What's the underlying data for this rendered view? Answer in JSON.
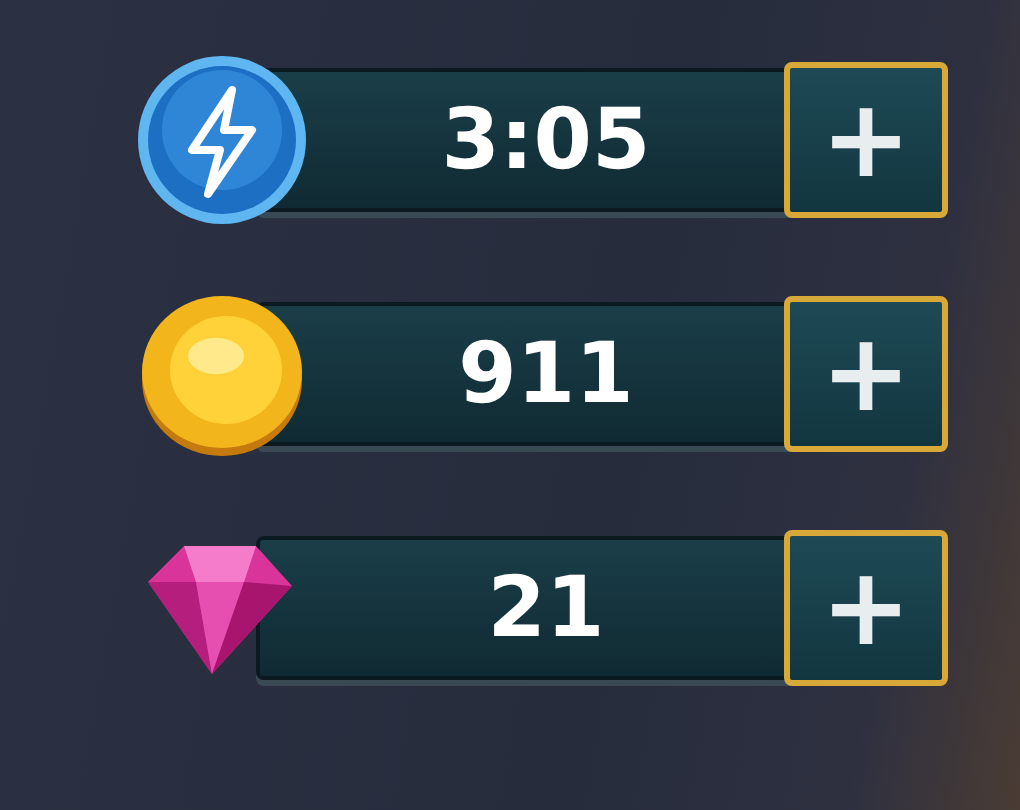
{
  "resources": [
    {
      "kind": "energy",
      "value": "3:05",
      "action": "+"
    },
    {
      "kind": "coins",
      "value": "911",
      "action": "+"
    },
    {
      "kind": "gems",
      "value": "21",
      "action": "+"
    }
  ]
}
